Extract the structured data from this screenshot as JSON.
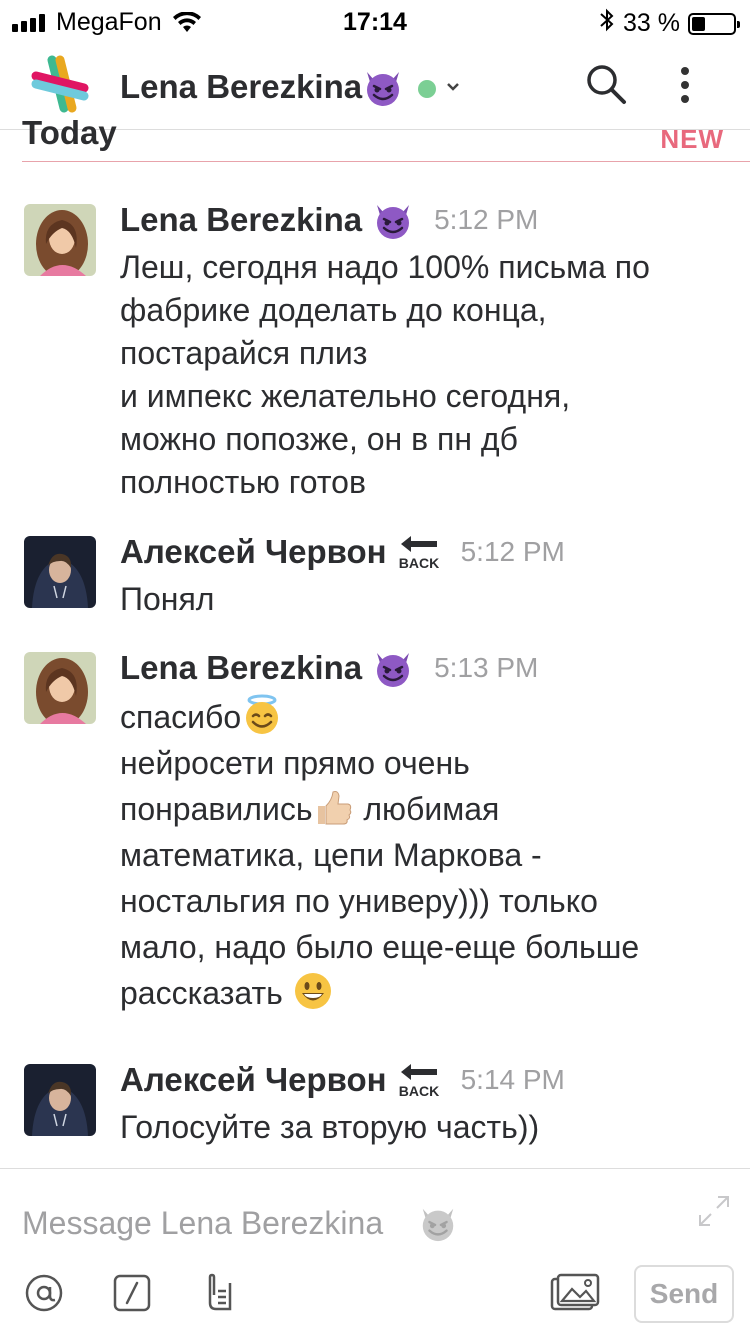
{
  "status_bar": {
    "carrier": "MegaFon",
    "time": "17:14",
    "battery_percent": "33 %",
    "battery_level": 0.33,
    "icons": [
      "signal-icon",
      "wifi-icon",
      "bluetooth-icon",
      "battery-icon"
    ]
  },
  "header": {
    "title": "Lena Berezkina",
    "title_emoji": "smiling-imp-emoji",
    "presence": "online",
    "presence_color": "#7bcf94",
    "icons": [
      "slack-logo",
      "search-icon",
      "more-vertical-icon",
      "chevron-down-icon"
    ]
  },
  "divider": {
    "day_label": "Today",
    "new_label": "NEW",
    "new_color": "#e8697d"
  },
  "messages": [
    {
      "sender": "Lena Berezkina",
      "sender_emoji": "smiling-imp-emoji",
      "time": "5:12 PM",
      "lines": [
        "Леш, сегодня надо 100% письма по",
        "фабрике доделать до конца,",
        "постарайся плиз",
        "и импекс желательно сегодня,",
        "можно попозже, он в пн дб",
        "полностью готов"
      ]
    },
    {
      "sender": "Алексей Червон",
      "sender_emoji": "back-arrow-emoji",
      "time": "5:12 PM",
      "text": "Понял"
    },
    {
      "sender": "Lena Berezkina",
      "sender_emoji": "smiling-imp-emoji",
      "time": "5:13 PM",
      "line1": "спасибо",
      "line2": "нейросети прямо очень",
      "line3a": "понравились",
      "line3b": " любимая",
      "line4": "математика, цепи Маркова -",
      "line5": "ностальгия по универу))) только",
      "line6": "мало, надо было еще-еще больше",
      "line7": "рассказать ",
      "emojis": [
        "smiling-face-with-halo-emoji",
        "thumbs-up-emoji",
        "grinning-face-emoji"
      ]
    },
    {
      "sender": "Алексей Червон",
      "sender_emoji": "back-arrow-emoji",
      "time": "5:14 PM",
      "text": "Голосуйте за вторую часть))"
    }
  ],
  "composer": {
    "placeholder": "Message Lena Berezkina",
    "placeholder_emoji": "smiling-imp-emoji",
    "send_label": "Send",
    "icons": [
      "at-icon",
      "slash-command-icon",
      "attach-file-icon",
      "photo-icon",
      "expand-icon"
    ]
  }
}
